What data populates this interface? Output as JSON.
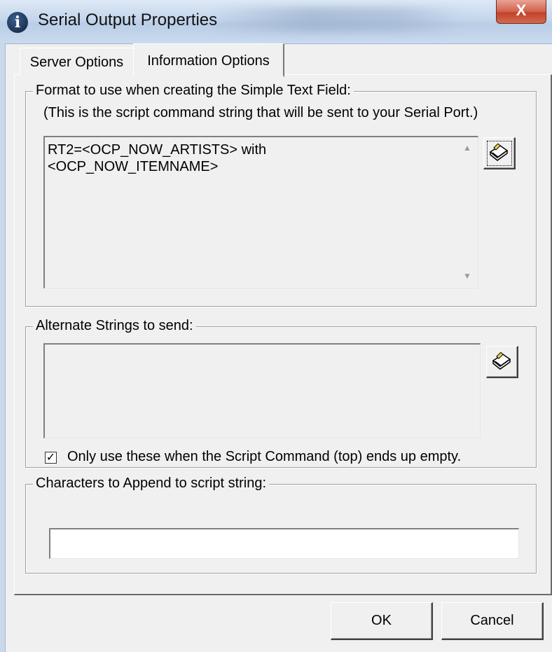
{
  "window": {
    "title": "Serial Output Properties",
    "close_glyph": "X",
    "app_icon": "info-icon"
  },
  "tabs": [
    {
      "label": "Server Options",
      "active": false
    },
    {
      "label": "Information Options",
      "active": true
    }
  ],
  "format_group": {
    "legend": "Format to use when creating the Simple Text Field:",
    "hint": "(This is the script command string that will be sent to your Serial Port.)",
    "value": "RT2=<OCP_NOW_ARTISTS> with\n<OCP_NOW_ITEMNAME>",
    "edit_icon": "edit-pencil-icon"
  },
  "alternate_group": {
    "legend": "Alternate Strings to send:",
    "value": "",
    "edit_icon": "edit-pencil-icon",
    "checkbox_label": "Only use these when the Script Command (top) ends up empty.",
    "checkbox_checked": true,
    "check_glyph": "✓"
  },
  "append_group": {
    "legend": "Characters to Append to script string:",
    "value": ""
  },
  "buttons": {
    "ok_label": "OK",
    "cancel_label": "Cancel"
  },
  "colors": {
    "dialog_bg": "#f0f0f0",
    "close_button": "#c9452c",
    "titlebar": "#c4d6ec"
  }
}
